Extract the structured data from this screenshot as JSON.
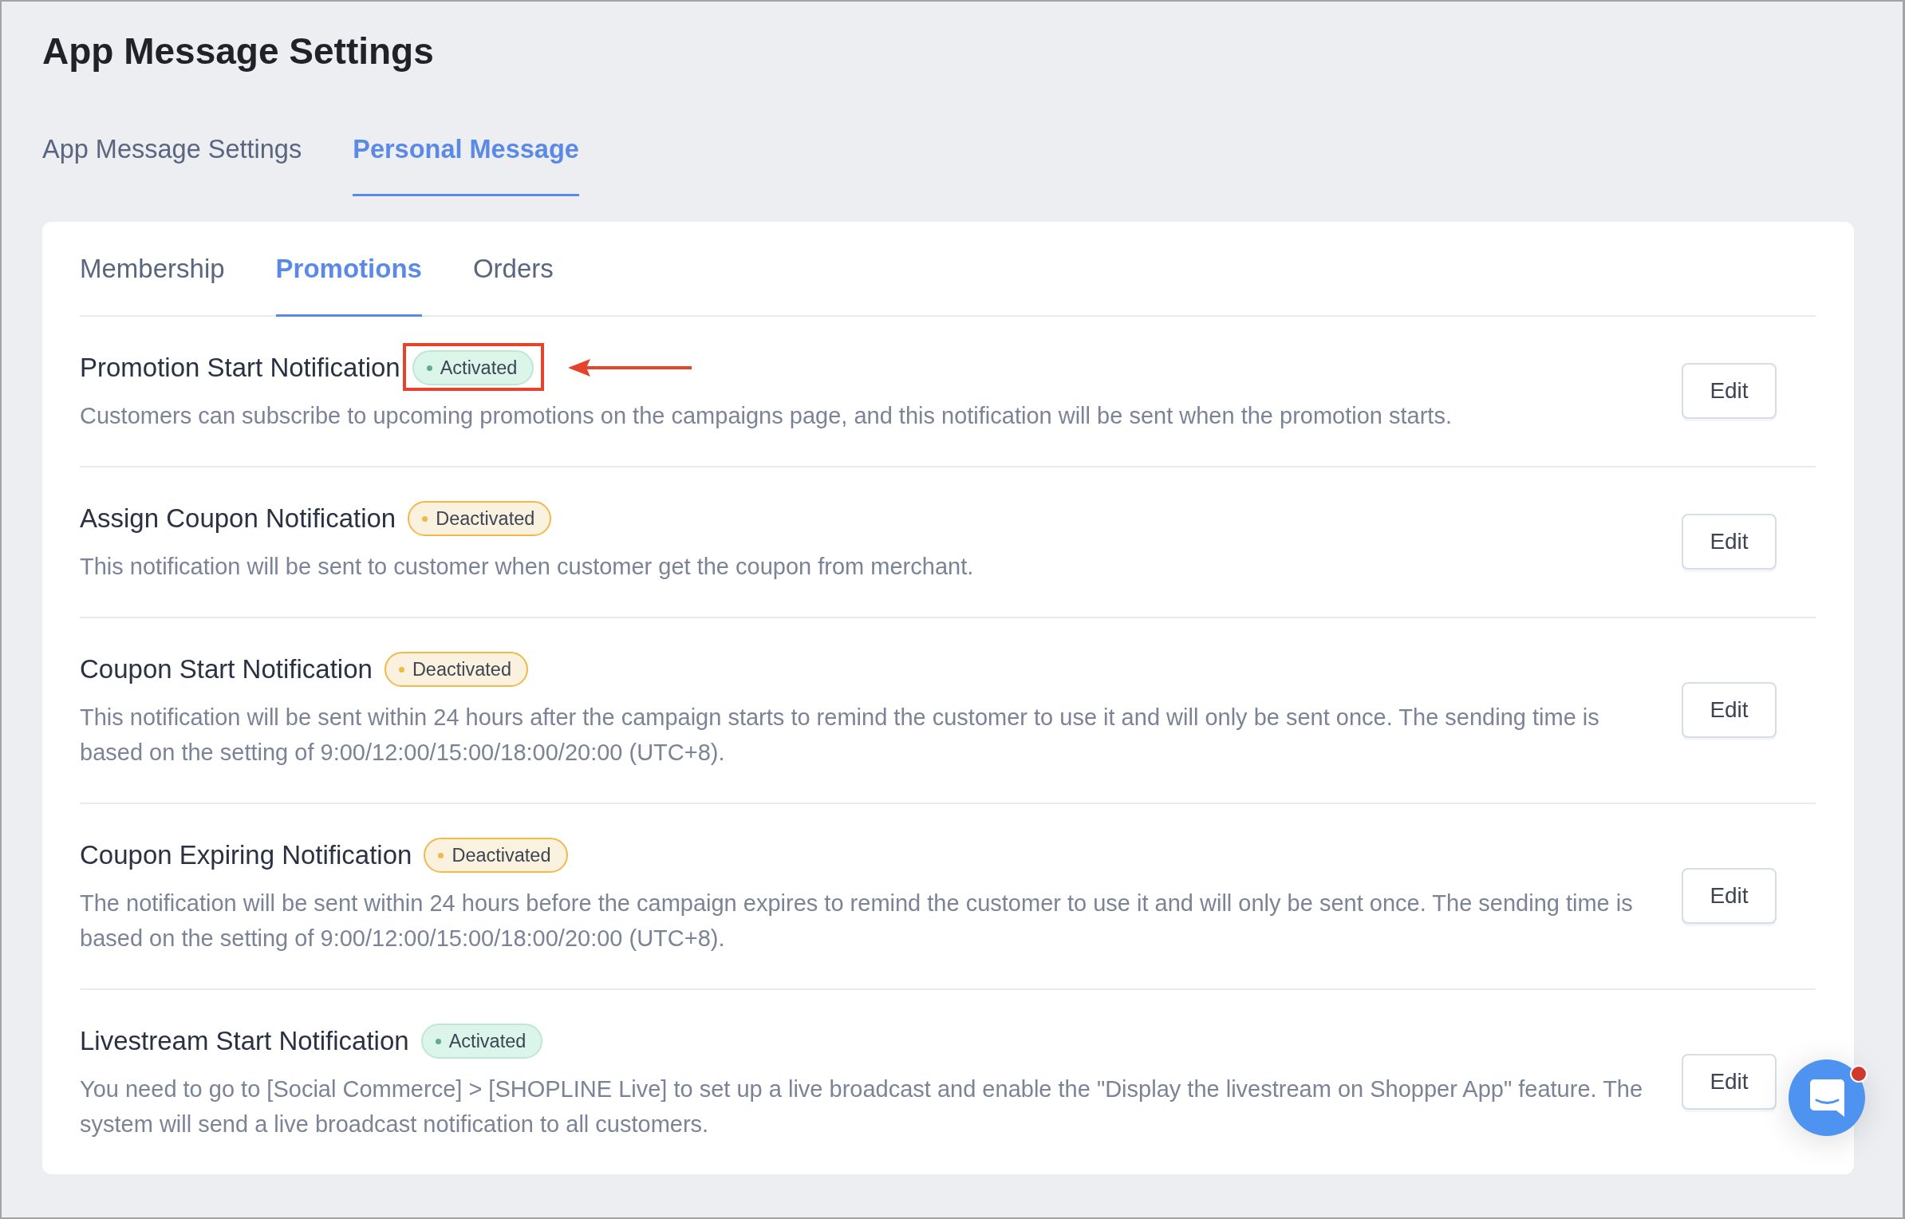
{
  "page": {
    "title": "App Message Settings"
  },
  "tabs": [
    {
      "label": "App Message Settings",
      "selected": false
    },
    {
      "label": "Personal Message",
      "selected": true
    }
  ],
  "subtabs": [
    {
      "label": "Membership",
      "selected": false
    },
    {
      "label": "Promotions",
      "selected": true
    },
    {
      "label": "Orders",
      "selected": false
    }
  ],
  "notifications": [
    {
      "title": "Promotion Start Notification",
      "status": "Activated",
      "active": true,
      "highlighted": true,
      "description": "Customers can subscribe to upcoming promotions on the campaigns page, and this notification will be sent when the promotion starts.",
      "button": "Edit"
    },
    {
      "title": "Assign Coupon Notification",
      "status": "Deactivated",
      "active": false,
      "highlighted": false,
      "description": "This notification will be sent to customer when customer get the coupon from merchant.",
      "button": "Edit"
    },
    {
      "title": "Coupon Start Notification",
      "status": "Deactivated",
      "active": false,
      "highlighted": false,
      "description": "This notification will be sent within 24 hours after the campaign starts to remind the customer to use it and will only be sent once. The sending time is based on the setting of 9:00/12:00/15:00/18:00/20:00 (UTC+8).",
      "button": "Edit"
    },
    {
      "title": "Coupon Expiring Notification",
      "status": "Deactivated",
      "active": false,
      "highlighted": false,
      "description": "The notification will be sent within 24 hours before the campaign expires to remind the customer to use it and will only be sent once. The sending time is based on the setting of 9:00/12:00/15:00/18:00/20:00 (UTC+8).",
      "button": "Edit"
    },
    {
      "title": "Livestream Start Notification",
      "status": "Activated",
      "active": true,
      "highlighted": false,
      "description": "You need to go to [Social Commerce] > [SHOPLINE Live] to set up a live broadcast and enable the \"Display the livestream on Shopper App\" feature. The system will send a live broadcast notification to all customers.",
      "button": "Edit"
    }
  ],
  "chat": {
    "unread": true
  }
}
